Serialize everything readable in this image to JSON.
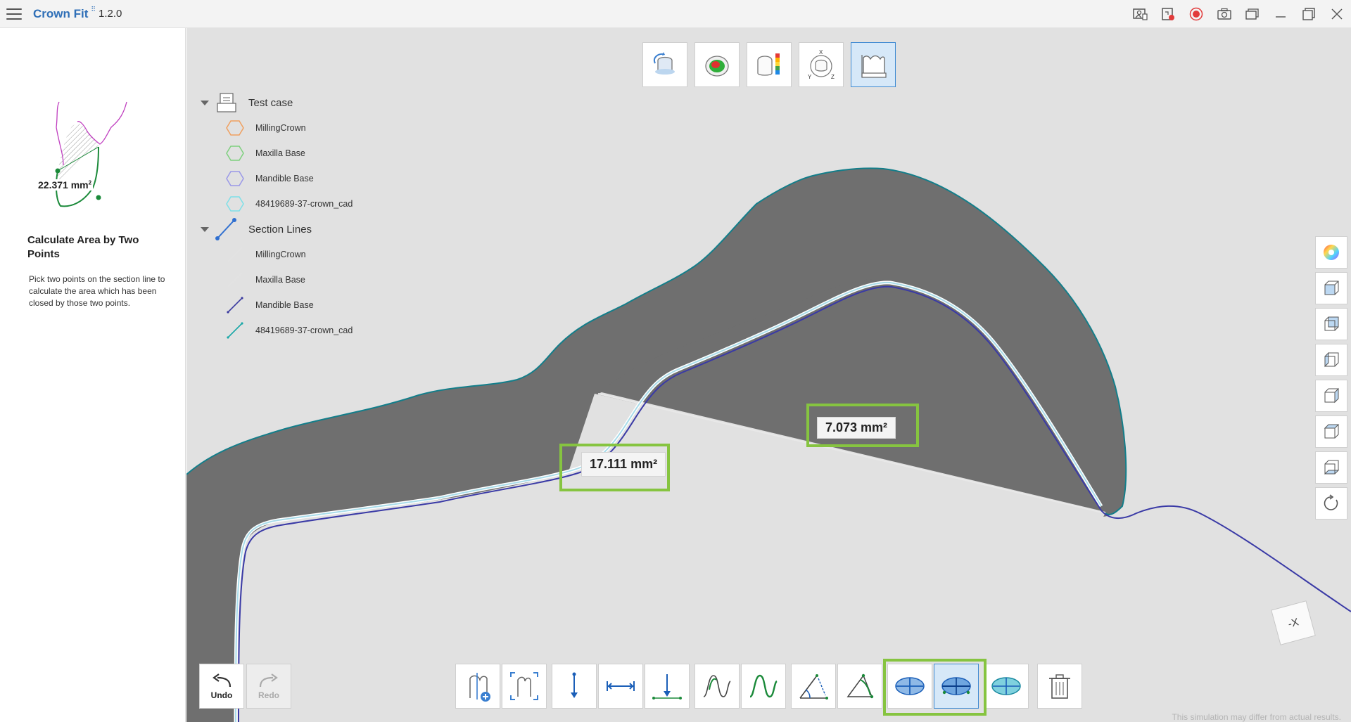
{
  "app": {
    "title": "Crown Fit",
    "version": "1.2.0"
  },
  "left_panel": {
    "illustration_value": "22.371 mm",
    "title": "Calculate Area by Two Points",
    "description": "Pick two points on the section line to calculate the area which has been closed by those two points."
  },
  "tree": {
    "groups": [
      {
        "label": "Test case",
        "items": [
          {
            "label": "MillingCrown",
            "color": "#f0a060"
          },
          {
            "label": "Maxilla Base",
            "color": "#7ed07e"
          },
          {
            "label": "Mandible Base",
            "color": "#9a98e8"
          },
          {
            "label": "48419689-37-crown_cad",
            "color": "#7ee0e8"
          }
        ]
      },
      {
        "label": "Section Lines",
        "items": [
          {
            "label": "MillingCrown",
            "color": "#e6e6e6"
          },
          {
            "label": "Maxilla Base",
            "color": "#e6e6e6"
          },
          {
            "label": "Mandible Base",
            "color": "#3c3ca0"
          },
          {
            "label": "48419689-37-crown_cad",
            "color": "#1aa8a8"
          }
        ]
      }
    ]
  },
  "measurements": {
    "left": "17.111 mm²",
    "right": "7.073 mm²"
  },
  "undo": {
    "undo_label": "Undo",
    "redo_label": "Redo"
  },
  "disclaimer": "This simulation may differ from actual results.",
  "nav_cube_label": "-X"
}
